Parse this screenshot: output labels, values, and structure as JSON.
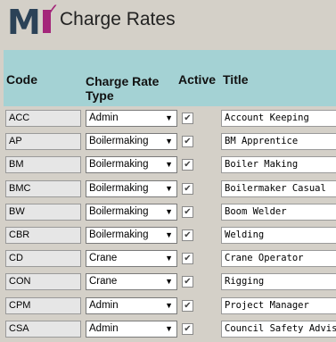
{
  "header": {
    "logo_letter": "M",
    "title": "Charge Rates"
  },
  "columns": {
    "code": "Code",
    "charge_rate_type": "Charge Rate Type",
    "active": "Active",
    "title": "Title"
  },
  "rows": [
    {
      "code": "ACC",
      "type": "Admin",
      "active": true,
      "title": "Account Keeping"
    },
    {
      "code": "AP",
      "type": "Boilermaking",
      "active": true,
      "title": "BM Apprentice"
    },
    {
      "code": "BM",
      "type": "Boilermaking",
      "active": true,
      "title": "Boiler Making"
    },
    {
      "code": "BMC",
      "type": "Boilermaking",
      "active": true,
      "title": "Boilermaker Casual"
    },
    {
      "code": "BW",
      "type": "Boilermaking",
      "active": true,
      "title": "Boom Welder"
    },
    {
      "code": "CBR",
      "type": "Boilermaking",
      "active": true,
      "title": "Welding"
    },
    {
      "code": "CD",
      "type": "Crane",
      "active": true,
      "title": "Crane Operator"
    },
    {
      "code": "CON",
      "type": "Crane",
      "active": true,
      "title": "Rigging"
    },
    {
      "code": "CPM",
      "type": "Admin",
      "active": true,
      "title": "Project Manager"
    },
    {
      "code": "CSA",
      "type": "Admin",
      "active": true,
      "title": "Council Safety Advisor"
    }
  ],
  "colors": {
    "background": "#d4d0c8",
    "header_band": "#a4d2d4",
    "brand_navy": "#2b4257",
    "brand_magenta": "#a4267a"
  }
}
